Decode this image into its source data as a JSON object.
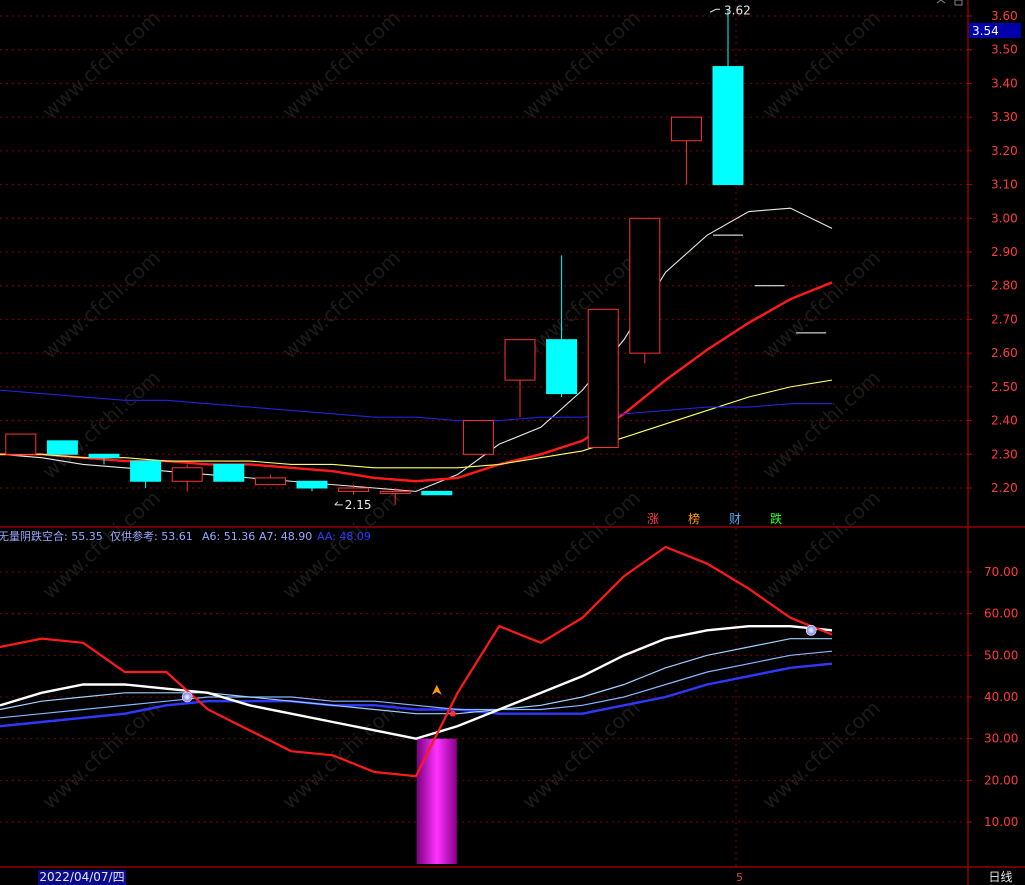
{
  "watermark": "www.cfchi.com",
  "colors": {
    "up": "#ff3232",
    "down": "#00ffff",
    "ma_white": "#e8e8e8",
    "ma_red": "#ff1a1a",
    "ma_yellow": "#ffff66",
    "ma_blue": "#2222dd",
    "grid": "#800000",
    "axis": "#b00000",
    "current_price_bg": "#0000aa",
    "magenta_bar": "#ff00ff"
  },
  "price_axis": {
    "ticks": [
      "3.60",
      "3.50",
      "3.40",
      "3.30",
      "3.20",
      "3.10",
      "3.00",
      "2.90",
      "2.80",
      "2.70",
      "2.60",
      "2.50",
      "2.40",
      "2.30",
      "2.20"
    ],
    "current_price": "3.54"
  },
  "price_labels": {
    "high": "3.62",
    "low": "2.15"
  },
  "badges": [
    {
      "text": "涨",
      "color": "#ff4040"
    },
    {
      "text": "榜",
      "color": "#ff9900"
    },
    {
      "text": "财",
      "color": "#4aa8ff"
    },
    {
      "text": "跌",
      "color": "#33ff33"
    }
  ],
  "indicator": {
    "legend": [
      {
        "text": "无量阴跌空合: 55.35",
        "color": "#9aa7ff"
      },
      {
        "text": "仅供参考: 53.61",
        "color": "#9aa7ff"
      },
      {
        "text": "A6: 51.36",
        "color": "#9aa7ff"
      },
      {
        "text": "A7: 48.90",
        "color": "#9aa7ff"
      },
      {
        "text": "AA: 48.09",
        "color": "#2f3cff"
      }
    ],
    "axis_ticks": [
      "70.00",
      "60.00",
      "50.00",
      "40.00",
      "30.00",
      "20.00",
      "10.00"
    ]
  },
  "status_bar": {
    "date": "2022/04/07/四",
    "mark": "5",
    "period": "日线"
  },
  "chart_data": [
    {
      "type": "candlestick",
      "ylim": [
        2.14,
        3.62
      ],
      "candles": [
        {
          "open": 2.3,
          "close": 2.36,
          "high": 2.36,
          "low": 2.3,
          "dir": "up"
        },
        {
          "open": 2.34,
          "close": 2.3,
          "high": 2.34,
          "low": 2.3,
          "dir": "down"
        },
        {
          "open": 2.3,
          "close": 2.29,
          "high": 2.3,
          "low": 2.27,
          "dir": "down"
        },
        {
          "open": 2.28,
          "close": 2.22,
          "high": 2.28,
          "low": 2.2,
          "dir": "down"
        },
        {
          "open": 2.22,
          "close": 2.26,
          "high": 2.27,
          "low": 2.19,
          "dir": "up"
        },
        {
          "open": 2.27,
          "close": 2.22,
          "high": 2.27,
          "low": 2.22,
          "dir": "down"
        },
        {
          "open": 2.21,
          "close": 2.23,
          "high": 2.24,
          "low": 2.21,
          "dir": "up"
        },
        {
          "open": 2.22,
          "close": 2.2,
          "high": 2.22,
          "low": 2.19,
          "dir": "down"
        },
        {
          "open": 2.19,
          "close": 2.2,
          "high": 2.21,
          "low": 2.18,
          "dir": "up"
        },
        {
          "open": 2.19,
          "close": 2.19,
          "high": 2.2,
          "low": 2.15,
          "dir": "up"
        },
        {
          "open": 2.18,
          "close": 2.19,
          "high": 2.19,
          "low": 2.18,
          "dir": "down"
        },
        {
          "open": 2.3,
          "close": 2.4,
          "high": 2.4,
          "low": 2.3,
          "dir": "up"
        },
        {
          "open": 2.52,
          "close": 2.64,
          "high": 2.64,
          "low": 2.41,
          "dir": "up"
        },
        {
          "open": 2.64,
          "close": 2.48,
          "high": 2.89,
          "low": 2.47,
          "dir": "down"
        },
        {
          "open": 2.32,
          "close": 2.73,
          "high": 2.73,
          "low": 2.32,
          "dir": "up"
        },
        {
          "open": 2.6,
          "close": 3.0,
          "high": 3.0,
          "low": 2.57,
          "dir": "up"
        },
        {
          "open": 3.23,
          "close": 3.3,
          "high": 3.3,
          "low": 3.1,
          "dir": "up"
        },
        {
          "open": 3.45,
          "close": 3.1,
          "high": 3.62,
          "low": 3.1,
          "dir": "down"
        }
      ],
      "ma_series": [
        {
          "color": "ma_white",
          "values": [
            2.3,
            2.29,
            2.27,
            2.26,
            2.25,
            2.24,
            2.23,
            2.22,
            2.21,
            2.2,
            2.19,
            2.24,
            2.33,
            2.38,
            2.49,
            2.64,
            2.84,
            2.95,
            3.02,
            3.03,
            2.97
          ]
        },
        {
          "color": "ma_red",
          "values": [
            2.3,
            2.3,
            2.29,
            2.28,
            2.28,
            2.27,
            2.27,
            2.26,
            2.25,
            2.23,
            2.22,
            2.23,
            2.27,
            2.3,
            2.34,
            2.42,
            2.52,
            2.61,
            2.69,
            2.76,
            2.81
          ]
        },
        {
          "color": "ma_yellow",
          "values": [
            2.3,
            2.3,
            2.29,
            2.29,
            2.28,
            2.28,
            2.28,
            2.27,
            2.27,
            2.26,
            2.26,
            2.26,
            2.27,
            2.29,
            2.31,
            2.35,
            2.39,
            2.43,
            2.47,
            2.5,
            2.52
          ]
        },
        {
          "color": "ma_blue",
          "values": [
            2.49,
            2.48,
            2.47,
            2.46,
            2.46,
            2.45,
            2.44,
            2.43,
            2.42,
            2.41,
            2.41,
            2.4,
            2.4,
            2.41,
            2.41,
            2.42,
            2.43,
            2.44,
            2.44,
            2.45,
            2.45
          ]
        }
      ],
      "ticks_right": [
        {
          "price": 2.95,
          "slot": 17.5
        },
        {
          "price": 2.8,
          "slot": 18.5
        },
        {
          "price": 2.66,
          "slot": 19.5
        }
      ]
    },
    {
      "type": "line",
      "ylim": [
        0,
        80
      ],
      "series": [
        {
          "name": "无量阴跌空合",
          "color": "#ff1a1a",
          "width": 2.2,
          "values": [
            52,
            54,
            53,
            46,
            46,
            37,
            32,
            27,
            26,
            22,
            21,
            41,
            57,
            53,
            59,
            69,
            76,
            72,
            66,
            59,
            55
          ]
        },
        {
          "name": "仅供参考",
          "color": "#ffffff",
          "width": 2.4,
          "values": [
            38,
            41,
            43,
            43,
            42,
            41,
            38,
            36,
            34,
            32,
            30,
            33,
            37,
            41,
            45,
            50,
            54,
            56,
            57,
            57,
            56
          ]
        },
        {
          "name": "A6",
          "color": "#9fd0ff",
          "width": 1.2,
          "values": [
            37,
            39,
            40,
            41,
            41,
            41,
            40,
            39,
            38,
            37,
            36,
            36,
            37,
            38,
            40,
            43,
            47,
            50,
            52,
            54,
            54
          ]
        },
        {
          "name": "A7",
          "color": "#8ab4ff",
          "width": 1.2,
          "values": [
            35,
            36,
            37,
            38,
            39,
            40,
            40,
            40,
            39,
            39,
            38,
            37,
            37,
            37,
            38,
            40,
            43,
            46,
            48,
            50,
            51
          ]
        },
        {
          "name": "AA",
          "color": "#3038ff",
          "width": 2.4,
          "values": [
            33,
            34,
            35,
            36,
            38,
            39,
            39,
            39,
            38,
            38,
            37,
            37,
            36,
            36,
            36,
            38,
            40,
            43,
            45,
            47,
            48
          ]
        }
      ],
      "bar": {
        "slot": 10.5,
        "from": 0,
        "to": 30,
        "color": "#ff00ff"
      },
      "signals": [
        {
          "slot": 4.5,
          "value": 40
        },
        {
          "slot": 19.5,
          "value": 56
        }
      ],
      "arrow": {
        "slot": 10.5,
        "value": 41
      }
    }
  ]
}
